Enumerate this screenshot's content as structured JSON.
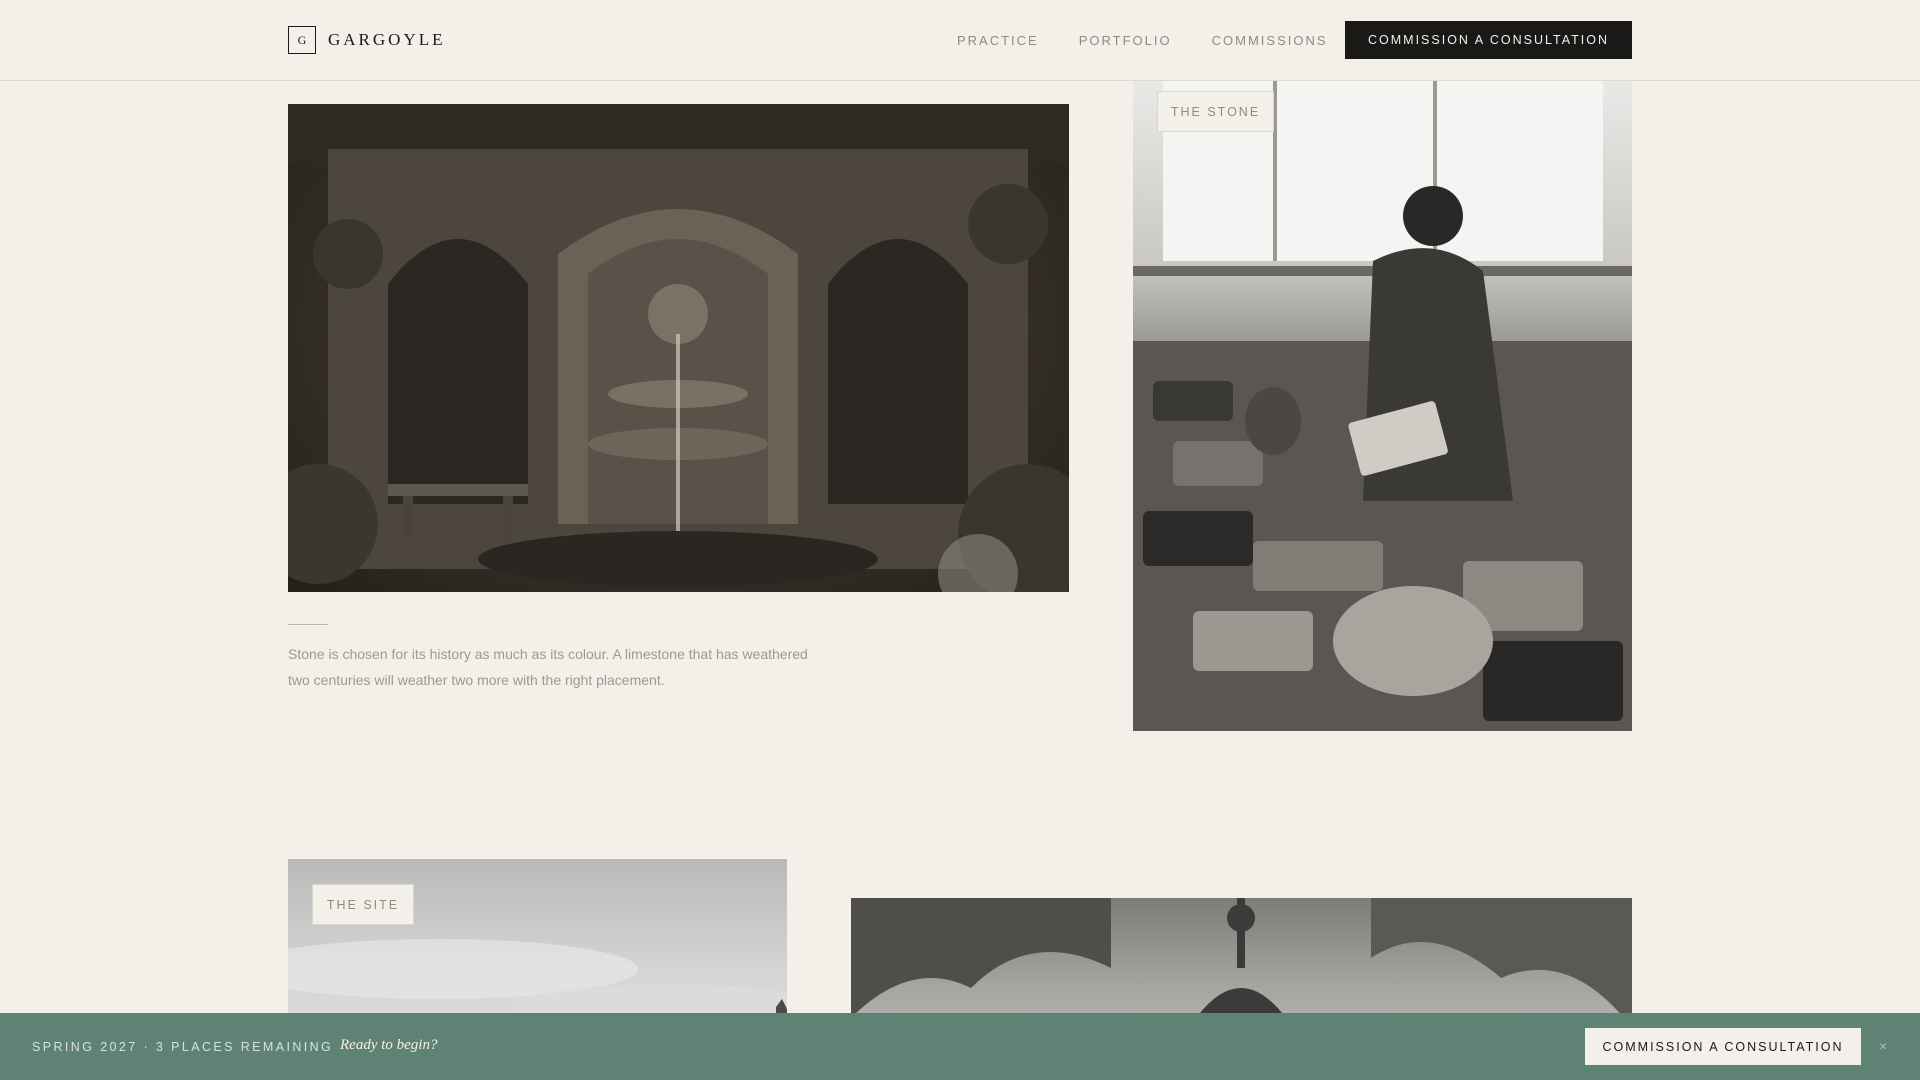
{
  "header": {
    "logo_mark": "G",
    "brand": "GARGOYLE",
    "nav": [
      "PRACTICE",
      "PORTFOLIO",
      "COMMISSIONS"
    ],
    "cta": "COMMISSION A CONSULTATION"
  },
  "content": {
    "tag_stone": "THE STONE",
    "tag_site": "THE SITE",
    "caption": "Stone is chosen for its history as much as its colour. A limestone that has weathered two centuries will weather two more with the right placement."
  },
  "bottom_bar": {
    "status": "SPRING 2027 · 3 PLACES REMAINING",
    "prompt": "Ready to begin?",
    "cta": "COMMISSION A CONSULTATION",
    "close": "×"
  },
  "colors": {
    "background": "#f3f0ea",
    "primary_button": "#1b1918",
    "bottom_bar": "#5e8273"
  }
}
